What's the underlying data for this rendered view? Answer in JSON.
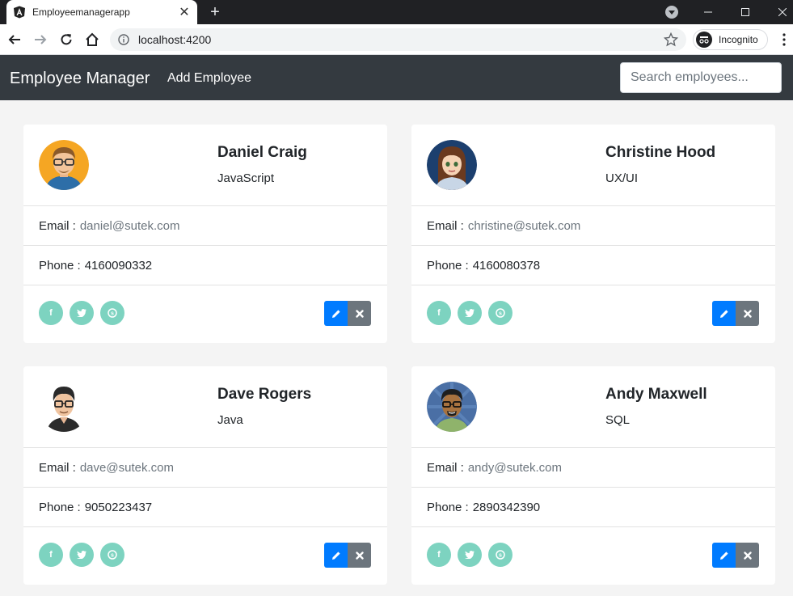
{
  "browser": {
    "tab_title": "Employeemanagerapp",
    "url": "localhost:4200",
    "incognito_label": "Incognito"
  },
  "navbar": {
    "brand": "Employee Manager",
    "add_link": "Add Employee",
    "search_placeholder": "Search employees..."
  },
  "labels": {
    "email": "Email :",
    "phone": "Phone :"
  },
  "icons": {
    "facebook": "facebook-icon",
    "twitter": "twitter-icon",
    "skype": "skype-icon",
    "edit": "pencil-icon",
    "delete": "close-icon"
  },
  "colors": {
    "navbar": "#343a40",
    "social": "#7dd3c0",
    "edit_button": "#007bff",
    "delete_button": "#6c757d"
  },
  "employees": [
    {
      "name": "Daniel Craig",
      "title": "JavaScript",
      "email": "daniel@sutek.com",
      "phone": "4160090332"
    },
    {
      "name": "Christine Hood",
      "title": "UX/UI",
      "email": "christine@sutek.com",
      "phone": "4160080378"
    },
    {
      "name": "Dave Rogers",
      "title": "Java",
      "email": "dave@sutek.com",
      "phone": "9050223437"
    },
    {
      "name": "Andy Maxwell",
      "title": "SQL",
      "email": "andy@sutek.com",
      "phone": "2890342390"
    }
  ]
}
